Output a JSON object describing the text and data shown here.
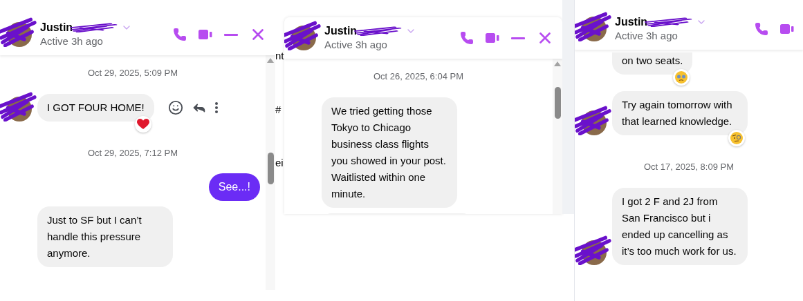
{
  "panels": [
    {
      "contact": {
        "name": "Justin",
        "status": "Active 3h ago"
      },
      "controls": [
        {
          "kind": "phone"
        },
        {
          "kind": "video"
        },
        {
          "kind": "minimize"
        },
        {
          "kind": "close"
        }
      ],
      "scrollbar": true,
      "messages": [
        {
          "kind": "timestamp",
          "text": "Oct 29, 2025, 5:09 PM"
        },
        {
          "kind": "incoming",
          "text": "I GOT FOUR HOME!",
          "avatar": true,
          "hover_actions": true,
          "reaction": {
            "kind": "heart"
          }
        },
        {
          "kind": "timestamp",
          "text": "Oct 29, 2025, 7:12 PM"
        },
        {
          "kind": "outgoing",
          "text": "See...!"
        },
        {
          "kind": "incoming",
          "text": "Just to SF but I can’t handle this pressure anymore.",
          "avatar": false,
          "hover_actions": false
        }
      ]
    },
    {
      "contact": {
        "name": "Justin",
        "status": "Active 3h ago"
      },
      "controls": [
        {
          "kind": "phone"
        },
        {
          "kind": "video"
        },
        {
          "kind": "minimize"
        },
        {
          "kind": "close"
        }
      ],
      "scrollbar": true,
      "background_fragments": [
        "nt",
        "#",
        "ei"
      ],
      "messages": [
        {
          "kind": "timestamp",
          "text": "Oct 26, 2025, 6:04 PM"
        },
        {
          "kind": "incoming",
          "text": "We tried getting those Tokyo to Chicago business class flights you showed in your post. Waitlisted within one minute.",
          "avatar": false,
          "hover_actions": false
        },
        {
          "kind": "partial"
        }
      ]
    },
    {
      "contact": {
        "name": "Justin",
        "status": "Active 3h ago"
      },
      "controls": [
        {
          "kind": "phone"
        },
        {
          "kind": "video"
        }
      ],
      "scrollbar": false,
      "messages": [
        {
          "kind": "incoming",
          "text": "on two seats.",
          "avatar": false,
          "hover_actions": false,
          "cut_top": true,
          "reaction": {
            "kind": "pleading"
          }
        },
        {
          "kind": "incoming",
          "text": "Try again tomorrow with that learned knowledge.",
          "avatar": true,
          "hover_actions": false,
          "reaction": {
            "kind": "monocle"
          }
        },
        {
          "kind": "timestamp",
          "text": "Oct 17, 2025, 8:09 PM"
        },
        {
          "kind": "incoming",
          "text": "I got 2 F and 2J from San Francisco but i ended up cancelling as it’s too much work for us.",
          "avatar": true,
          "hover_actions": false
        }
      ]
    }
  ]
}
